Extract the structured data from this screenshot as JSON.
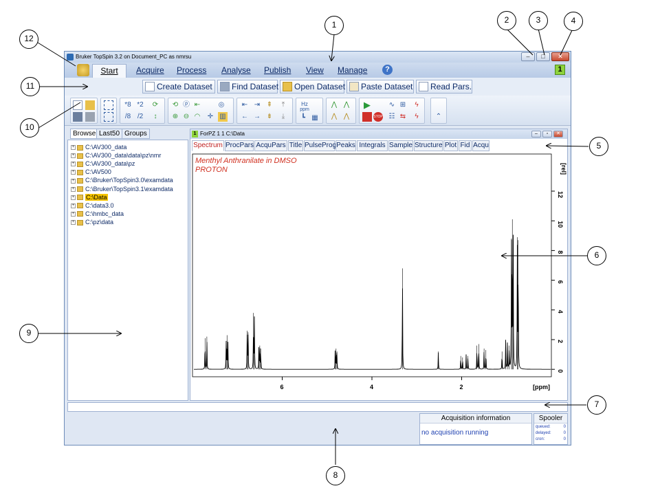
{
  "window": {
    "title": "Bruker TopSpin 3.2 on Document_PC as nmrsu",
    "min_glyph": "–",
    "max_glyph": "□",
    "close_glyph": "✕"
  },
  "menu": {
    "items": [
      {
        "label": "Start"
      },
      {
        "label": "Acquire"
      },
      {
        "label": "Process"
      },
      {
        "label": "Analyse"
      },
      {
        "label": "Publish"
      },
      {
        "label": "View"
      },
      {
        "label": "Manage"
      }
    ],
    "help_glyph": "?",
    "window_number": "1"
  },
  "command_bar": {
    "buttons": [
      {
        "label": "Create Dataset"
      },
      {
        "label": "Find Dataset"
      },
      {
        "label": "Open Dataset"
      },
      {
        "label": "Paste Dataset"
      },
      {
        "label": "Read Pars."
      }
    ]
  },
  "toolbar": {
    "texts": [
      "*8",
      "*2",
      "/8",
      "/2",
      "Hz",
      "ppm"
    ]
  },
  "browser": {
    "tabs": [
      "Browser",
      "Last50",
      "Groups"
    ],
    "items": [
      {
        "label": "C:\\AV300_data"
      },
      {
        "label": "C:\\AV300_data\\data\\pz\\nmr"
      },
      {
        "label": "C:\\AV300_data\\pz"
      },
      {
        "label": "C:\\AV500"
      },
      {
        "label": "C:\\Bruker\\TopSpin3.0\\examdata"
      },
      {
        "label": "C:\\Bruker\\TopSpin3.1\\examdata"
      },
      {
        "label": "C:\\Data"
      },
      {
        "label": "C:\\data3.0"
      },
      {
        "label": "C:\\hmbc_data"
      },
      {
        "label": "C:\\pz\\data"
      }
    ],
    "selected_index": 6
  },
  "data_window": {
    "number": "1",
    "title": "ForPZ 1 1 C:\\Data",
    "tabs": [
      "Spectrum",
      "ProcPars",
      "AcquPars",
      "Title",
      "PulseProg",
      "Peaks",
      "Integrals",
      "Sample",
      "Structure",
      "Plot",
      "Fid",
      "Acqu"
    ],
    "active_tab": "Spectrum"
  },
  "chart_data": {
    "type": "line",
    "title": "Menthyl Anthranilate in DMSO",
    "subtitle": "PROTON",
    "xlabel": "[ppm]",
    "ylabel": "[rel]",
    "x_reversed": true,
    "xlim": [
      8.0,
      0.0
    ],
    "ylim": [
      -0.5,
      14.5
    ],
    "x_ticks": [
      6,
      4,
      2
    ],
    "y_ticks": [
      0,
      2,
      4,
      6,
      8,
      10,
      12
    ],
    "peaks": [
      {
        "x": 7.72,
        "y": 2.1
      },
      {
        "x": 7.68,
        "y": 2.2
      },
      {
        "x": 7.25,
        "y": 1.9
      },
      {
        "x": 7.23,
        "y": 2.3
      },
      {
        "x": 7.21,
        "y": 1.8
      },
      {
        "x": 6.78,
        "y": 2.6
      },
      {
        "x": 6.76,
        "y": 2.5
      },
      {
        "x": 6.64,
        "y": 3.8
      },
      {
        "x": 6.62,
        "y": 3.5
      },
      {
        "x": 6.52,
        "y": 1.5
      },
      {
        "x": 6.5,
        "y": 1.6
      },
      {
        "x": 6.48,
        "y": 1.4
      },
      {
        "x": 4.82,
        "y": 1.2
      },
      {
        "x": 4.8,
        "y": 1.4
      },
      {
        "x": 4.78,
        "y": 1.2
      },
      {
        "x": 3.32,
        "y": 6.8
      },
      {
        "x": 2.52,
        "y": 1.2
      },
      {
        "x": 2.02,
        "y": 0.9
      },
      {
        "x": 1.98,
        "y": 0.8
      },
      {
        "x": 1.9,
        "y": 1.0
      },
      {
        "x": 1.86,
        "y": 0.9
      },
      {
        "x": 1.66,
        "y": 1.6
      },
      {
        "x": 1.62,
        "y": 1.7
      },
      {
        "x": 1.5,
        "y": 1.4
      },
      {
        "x": 1.46,
        "y": 1.3
      },
      {
        "x": 1.1,
        "y": 1.2
      },
      {
        "x": 1.02,
        "y": 2.0
      },
      {
        "x": 0.98,
        "y": 1.8
      },
      {
        "x": 0.94,
        "y": 1.6
      },
      {
        "x": 0.89,
        "y": 8.8
      },
      {
        "x": 0.87,
        "y": 10.1
      },
      {
        "x": 0.85,
        "y": 8.7
      },
      {
        "x": 0.76,
        "y": 8.9
      },
      {
        "x": 0.74,
        "y": 8.7
      }
    ],
    "colors": {
      "trace": "#000000",
      "label": "#d03020"
    }
  },
  "status": {
    "acq_header": "Acquisition information",
    "acq_status": "no acquisition running",
    "spooler_header": "Spooler",
    "spooler": [
      {
        "label": "queued:",
        "value": "0"
      },
      {
        "label": "delayed:",
        "value": "0"
      },
      {
        "label": "cron:",
        "value": "0"
      }
    ]
  },
  "callouts": [
    "1",
    "2",
    "3",
    "4",
    "5",
    "6",
    "7",
    "8",
    "9",
    "10",
    "11",
    "12"
  ]
}
